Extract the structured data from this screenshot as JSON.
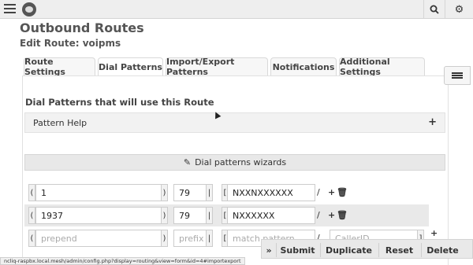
{
  "header": {
    "search_icon": "search-icon",
    "settings_icon": "gear-icon"
  },
  "page": {
    "title": "Outbound Routes",
    "subtitle": "Edit Route: voipms"
  },
  "tabs": [
    {
      "label": "Route Settings"
    },
    {
      "label": "Dial Patterns",
      "active": true
    },
    {
      "label": "Import/Export Patterns"
    },
    {
      "label": "Notifications"
    },
    {
      "label": "Additional Settings"
    }
  ],
  "section": {
    "title": "Dial Patterns that will use this Route",
    "pattern_help": "Pattern Help",
    "wizards_label": "Dial patterns wizards"
  },
  "patterns": [
    {
      "prepend": "1",
      "prefix": "79",
      "match": "NXXNXXXXXX",
      "callerid": ""
    },
    {
      "prepend": "1937",
      "prefix": "79",
      "match": "NXXXXXX",
      "callerid": ""
    }
  ],
  "new_pattern": {
    "prepend_placeholder": "prepend",
    "prefix_placeholder": "prefix",
    "match_placeholder": "match pattern",
    "callerid_placeholder": "CallerID"
  },
  "actions": {
    "submit": "Submit",
    "duplicate": "Duplicate",
    "reset": "Reset",
    "delete": "Delete"
  },
  "status_url": "ncliq-raspbx.local.mesh/admin/config.php?display=routing&view=form&id=4#importexport"
}
